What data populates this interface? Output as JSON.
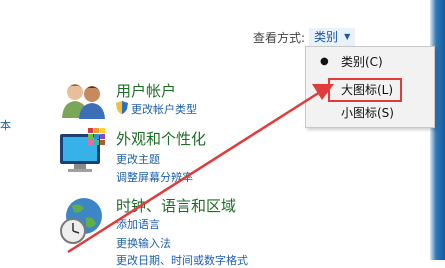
{
  "view_by": {
    "label": "查看方式:",
    "value": "类别"
  },
  "dropdown": {
    "items": [
      {
        "label": "类别(C)",
        "selected": true
      },
      {
        "label": "大图标(L)",
        "highlighted": true
      },
      {
        "label": "小图标(S)"
      }
    ]
  },
  "left_fragment": "本",
  "categories": {
    "user_accounts": {
      "title": "用户帐户",
      "links": [
        "更改帐户类型"
      ]
    },
    "appearance": {
      "title": "外观和个性化",
      "links": [
        "更改主题",
        "调整屏幕分辨率"
      ]
    },
    "clock_region": {
      "title": "时钟、语言和区域",
      "links": [
        "添加语言",
        "更换输入法",
        "更改日期、时间或数字格式"
      ]
    }
  },
  "colors": {
    "title_green": "#1e6d28",
    "link_blue": "#1d5fae",
    "annotation_red": "#e23b3b"
  }
}
